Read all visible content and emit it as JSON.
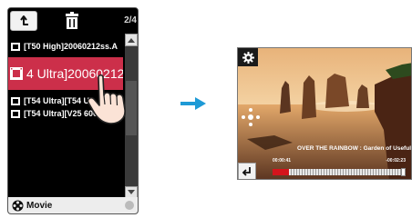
{
  "browser": {
    "page_indicator": "2/4",
    "files": [
      {
        "name": "[T50 High]20060212ss.A",
        "selected": false
      },
      {
        "name": "4 Ultra]20060212",
        "selected": true
      },
      {
        "name": "[T54 Ultra][T54 U",
        "selected": false
      },
      {
        "name": "[T54 Ultra][V25 600",
        "selected": false
      }
    ],
    "mode_label": "Movie"
  },
  "player": {
    "track_title": "OVER THE RAINBOW : Garden of Useful",
    "time_elapsed": "00:00:41",
    "time_remaining": "-00:02:23",
    "progress": 0.12
  },
  "colors": {
    "selection": "#cc2f4a",
    "arrow": "#1e9ad6",
    "progress": "#d4141c"
  },
  "icons": [
    "back-arrow-icon",
    "trash-icon",
    "film-icon",
    "hand-pointer-icon",
    "movie-reel-icon",
    "gear-icon",
    "dpad-icon",
    "return-icon",
    "right-arrow-icon"
  ]
}
